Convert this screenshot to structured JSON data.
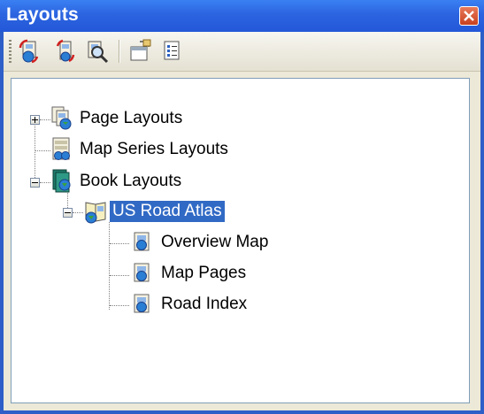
{
  "window": {
    "title": "Layouts"
  },
  "toolbar": {
    "buttons": [
      {
        "icon": "refresh-layouts-icon"
      },
      {
        "icon": "new-layout-icon"
      },
      {
        "icon": "find-layout-icon"
      },
      {
        "icon": "properties-icon"
      },
      {
        "icon": "list-view-icon"
      }
    ]
  },
  "tree": {
    "page_layouts": "Page Layouts",
    "map_series_layouts": "Map Series Layouts",
    "book_layouts": "Book Layouts",
    "us_road_atlas": "US Road Atlas",
    "overview_map": "Overview Map",
    "map_pages": "Map Pages",
    "road_index": "Road Index"
  },
  "colors": {
    "titlebar": "#2c64e0",
    "selection": "#316ac5",
    "close_button": "#d4512e"
  }
}
